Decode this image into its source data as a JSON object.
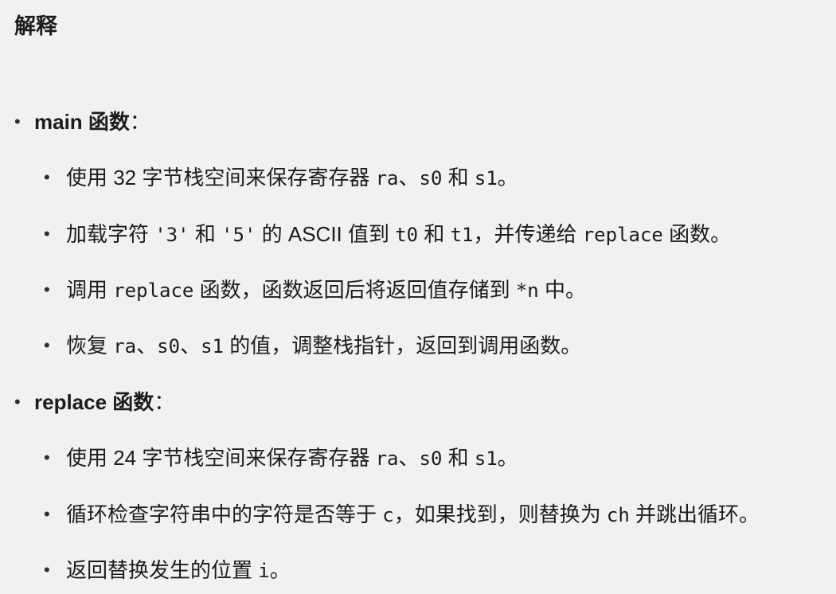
{
  "heading": "解释",
  "bullet_glyph": "•",
  "main_section": {
    "title_code": "main",
    "title_text": " 函数",
    "title_suffix": "：",
    "items": [
      {
        "p1": "使用 32 字节栈空间来保存寄存器 ",
        "c1": "ra",
        "p2": "、",
        "c2": "s0",
        "p3": " 和 ",
        "c3": "s1",
        "p4": "。"
      },
      {
        "p1": "加载字符 ",
        "c1": "'3'",
        "p2": " 和 ",
        "c2": "'5'",
        "p3": " 的 ASCII 值到 ",
        "c3": "t0",
        "p4": " 和 ",
        "c4": "t1",
        "p5": "，并传递给 ",
        "c5": "replace",
        "p6": " 函数。"
      },
      {
        "p1": "调用 ",
        "c1": "replace",
        "p2": " 函数，函数返回后将返回值存储到 ",
        "c2": "*n",
        "p3": " 中。"
      },
      {
        "p1": "恢复 ",
        "c1": "ra",
        "p2": "、",
        "c2": "s0",
        "p3": "、",
        "c3": "s1",
        "p4": " 的值，调整栈指针，返回到调用函数。"
      }
    ]
  },
  "replace_section": {
    "title_code": "replace",
    "title_text": " 函数",
    "title_suffix": "：",
    "items": [
      {
        "p1": "使用 24 字节栈空间来保存寄存器 ",
        "c1": "ra",
        "p2": "、",
        "c2": "s0",
        "p3": " 和 ",
        "c3": "s1",
        "p4": "。"
      },
      {
        "p1": "循环检查字符串中的字符是否等于 ",
        "c1": "c",
        "p2": "，如果找到，则替换为 ",
        "c2": "ch",
        "p3": " 并跳出循环。"
      },
      {
        "p1": "返回替换发生的位置 ",
        "c1": "i",
        "p2": "。"
      }
    ]
  }
}
